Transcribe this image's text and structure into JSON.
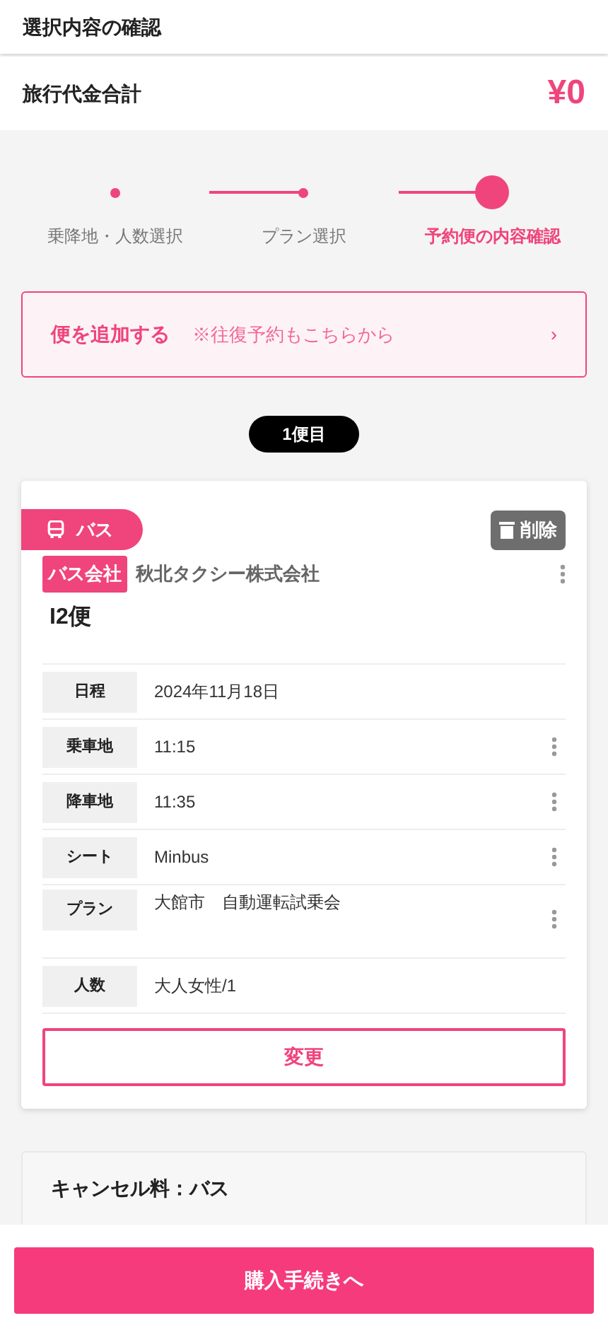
{
  "header": {
    "title": "選択内容の確認"
  },
  "total": {
    "label": "旅行代金合計",
    "amount": "¥0"
  },
  "steps": [
    {
      "label": "乗降地・人数選択",
      "current": false
    },
    {
      "label": "プラン選択",
      "current": false
    },
    {
      "label": "予約便の内容確認",
      "current": true
    }
  ],
  "add_trip": {
    "label": "便を追加する",
    "note": "※往復予約もこちらから",
    "chevron": "›"
  },
  "trip_badge": "1便目",
  "trip": {
    "type_tag": "バス",
    "delete_label": "削除",
    "company_tag": "バス会社",
    "company": "秋北タクシー株式会社",
    "name": "I2便",
    "rows": [
      {
        "label": "日程",
        "value": "2024年11月18日",
        "menu": false
      },
      {
        "label": "乗車地",
        "value": "11:15",
        "menu": true
      },
      {
        "label": "降車地",
        "value": "11:35",
        "menu": true
      },
      {
        "label": "シート",
        "value": "Minbus",
        "menu": true
      },
      {
        "label": "プラン",
        "value": "大館市　自動運転試乗会",
        "menu": true
      },
      {
        "label": "人数",
        "value": "大人女性/1",
        "menu": false
      }
    ],
    "change_label": "変更"
  },
  "cancel": {
    "title": "キャンセル料：バス"
  },
  "purchase_label": "購入手続きへ"
}
